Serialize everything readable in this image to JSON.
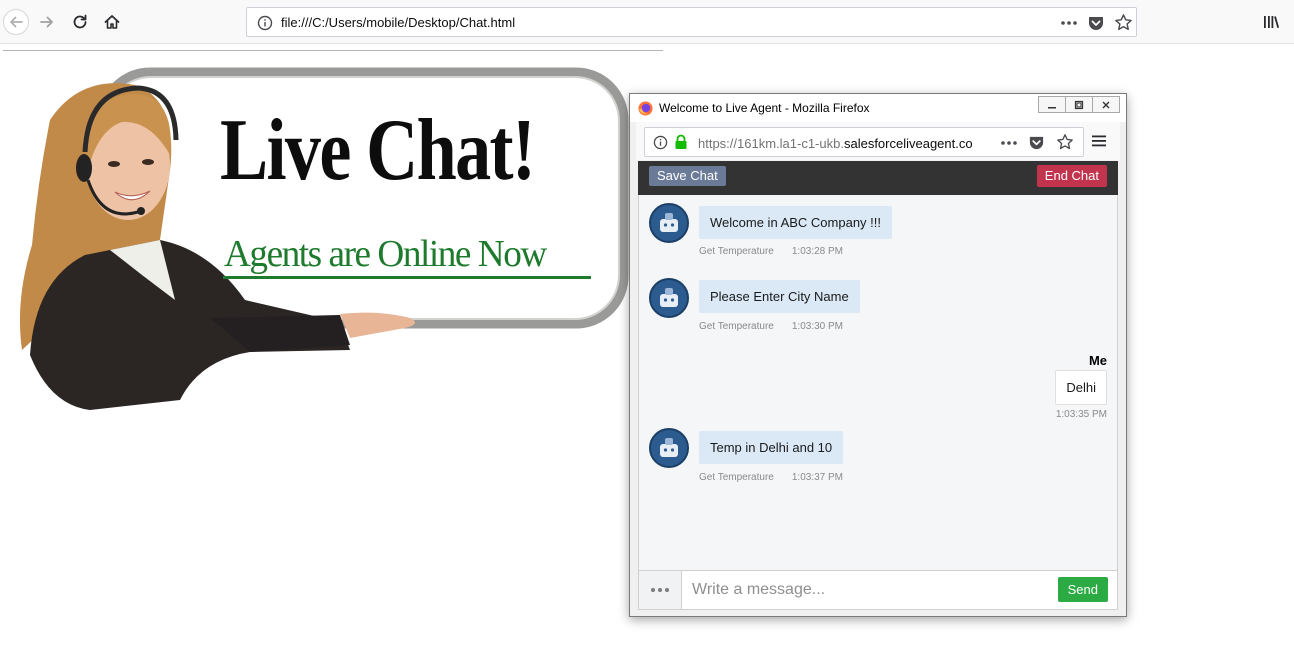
{
  "browser": {
    "url": "file:///C:/Users/mobile/Desktop/Chat.html",
    "icons": {
      "back": "arrow-left-icon",
      "forward": "arrow-right-icon",
      "reload": "reload-icon",
      "home": "home-icon",
      "info": "info-icon",
      "page_actions": "more-icon",
      "pocket": "pocket-icon",
      "bookmark": "star-icon",
      "library": "library-icon"
    }
  },
  "hero": {
    "title": "Live Chat!",
    "subtitle": "Agents are Online Now",
    "colors": {
      "title": "#0d0d0d",
      "subtitle": "#1e7a2c"
    }
  },
  "popup": {
    "window_title": "Welcome to Live Agent - Mozilla Firefox",
    "url_prefix": "https://161km.la1-c1-ukb.",
    "url_domain": "salesforceliveagent.co",
    "header": {
      "save_label": "Save Chat",
      "end_label": "End Chat"
    },
    "messages": [
      {
        "from": "agent",
        "text": "Welcome in ABC Company !!!",
        "sender": "Get Temperature",
        "time": "1:03:28 PM"
      },
      {
        "from": "agent",
        "text": "Please Enter City Name",
        "sender": "Get Temperature",
        "time": "1:03:30 PM"
      },
      {
        "from": "me",
        "label": "Me",
        "text": "Delhi",
        "time": "1:03:35 PM"
      },
      {
        "from": "agent",
        "text": "Temp in Delhi and 10",
        "sender": "Get Temperature",
        "time": "1:03:37 PM"
      }
    ],
    "input": {
      "placeholder": "Write a message..."
    },
    "send_label": "Send",
    "colors": {
      "header_bg": "#333333",
      "save_btn": "#6b7a97",
      "end_btn": "#c2334d",
      "send_btn": "#2cab45",
      "agent_bubble": "#dbe9f6"
    }
  }
}
